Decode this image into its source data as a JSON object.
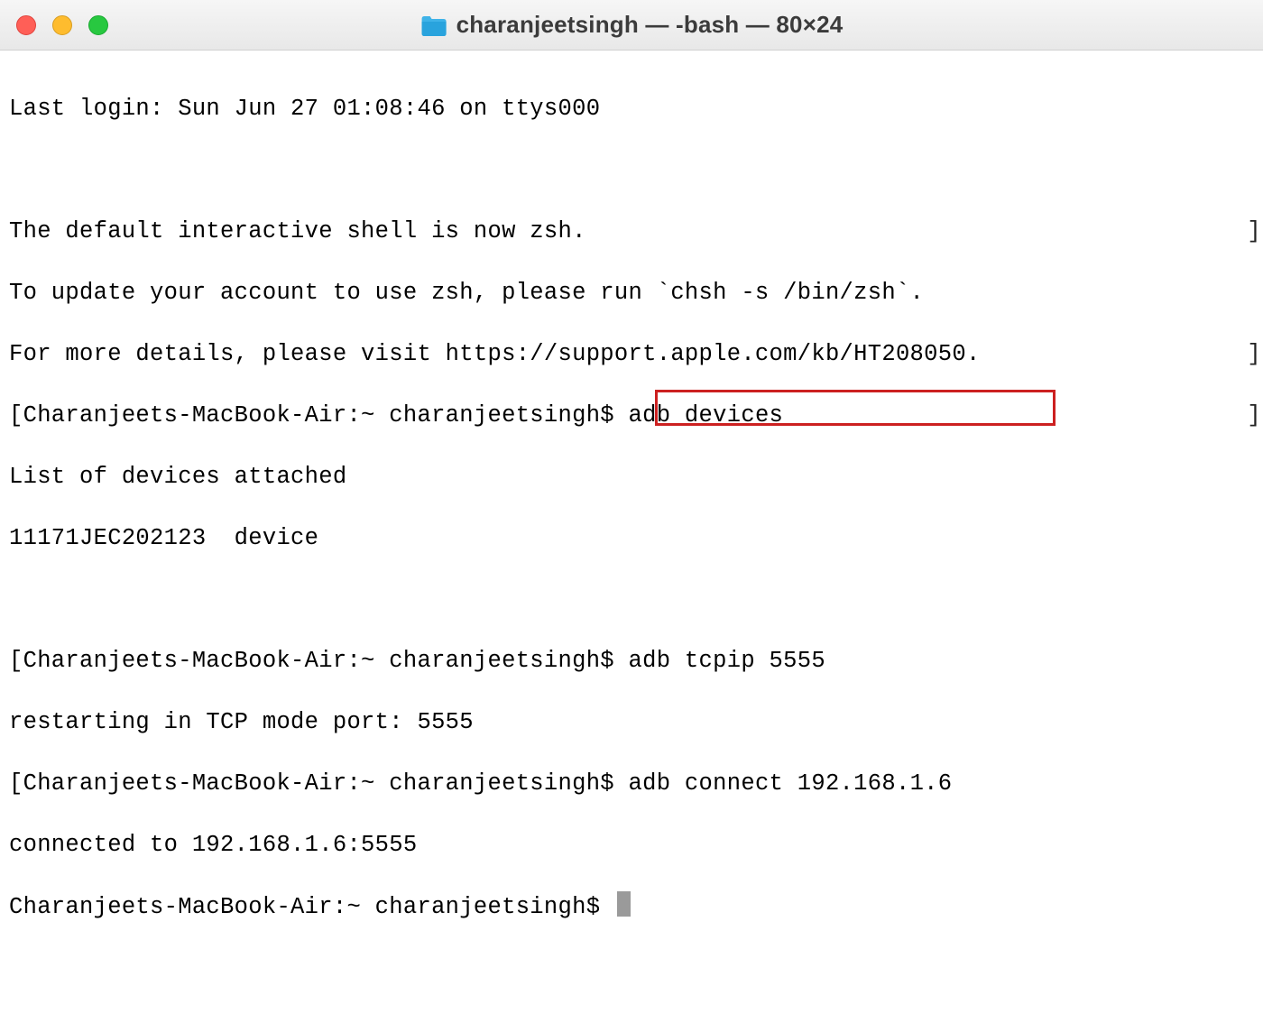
{
  "window": {
    "title": "charanjeetsingh — -bash — 80×24"
  },
  "terminal": {
    "lines": {
      "l0": "Last login: Sun Jun 27 01:08:46 on ttys000",
      "l1": "",
      "l2": "The default interactive shell is now zsh.",
      "l3": "To update your account to use zsh, please run `chsh -s /bin/zsh`.",
      "l4": "For more details, please visit https://support.apple.com/kb/HT208050.",
      "l5_prompt": "[Charanjeets-MacBook-Air:~ charanjeetsingh$ ",
      "l5_cmd": "adb devices",
      "l6": "List of devices attached",
      "l7": "11171JEC202123  device",
      "l8": "",
      "l9_prompt": "[Charanjeets-MacBook-Air:~ charanjeetsingh$ ",
      "l9_cmd": "adb tcpip 5555",
      "l10": "restarting in TCP mode port: 5555",
      "l11_prompt": "[Charanjeets-MacBook-Air:~ charanjeetsingh$ ",
      "l11_cmd": "adb connect 192.168.1.6",
      "l12": "connected to 192.168.1.6:5555",
      "l13_prompt": "Charanjeets-MacBook-Air:~ charanjeetsingh$ "
    },
    "right_bracket": "]"
  }
}
